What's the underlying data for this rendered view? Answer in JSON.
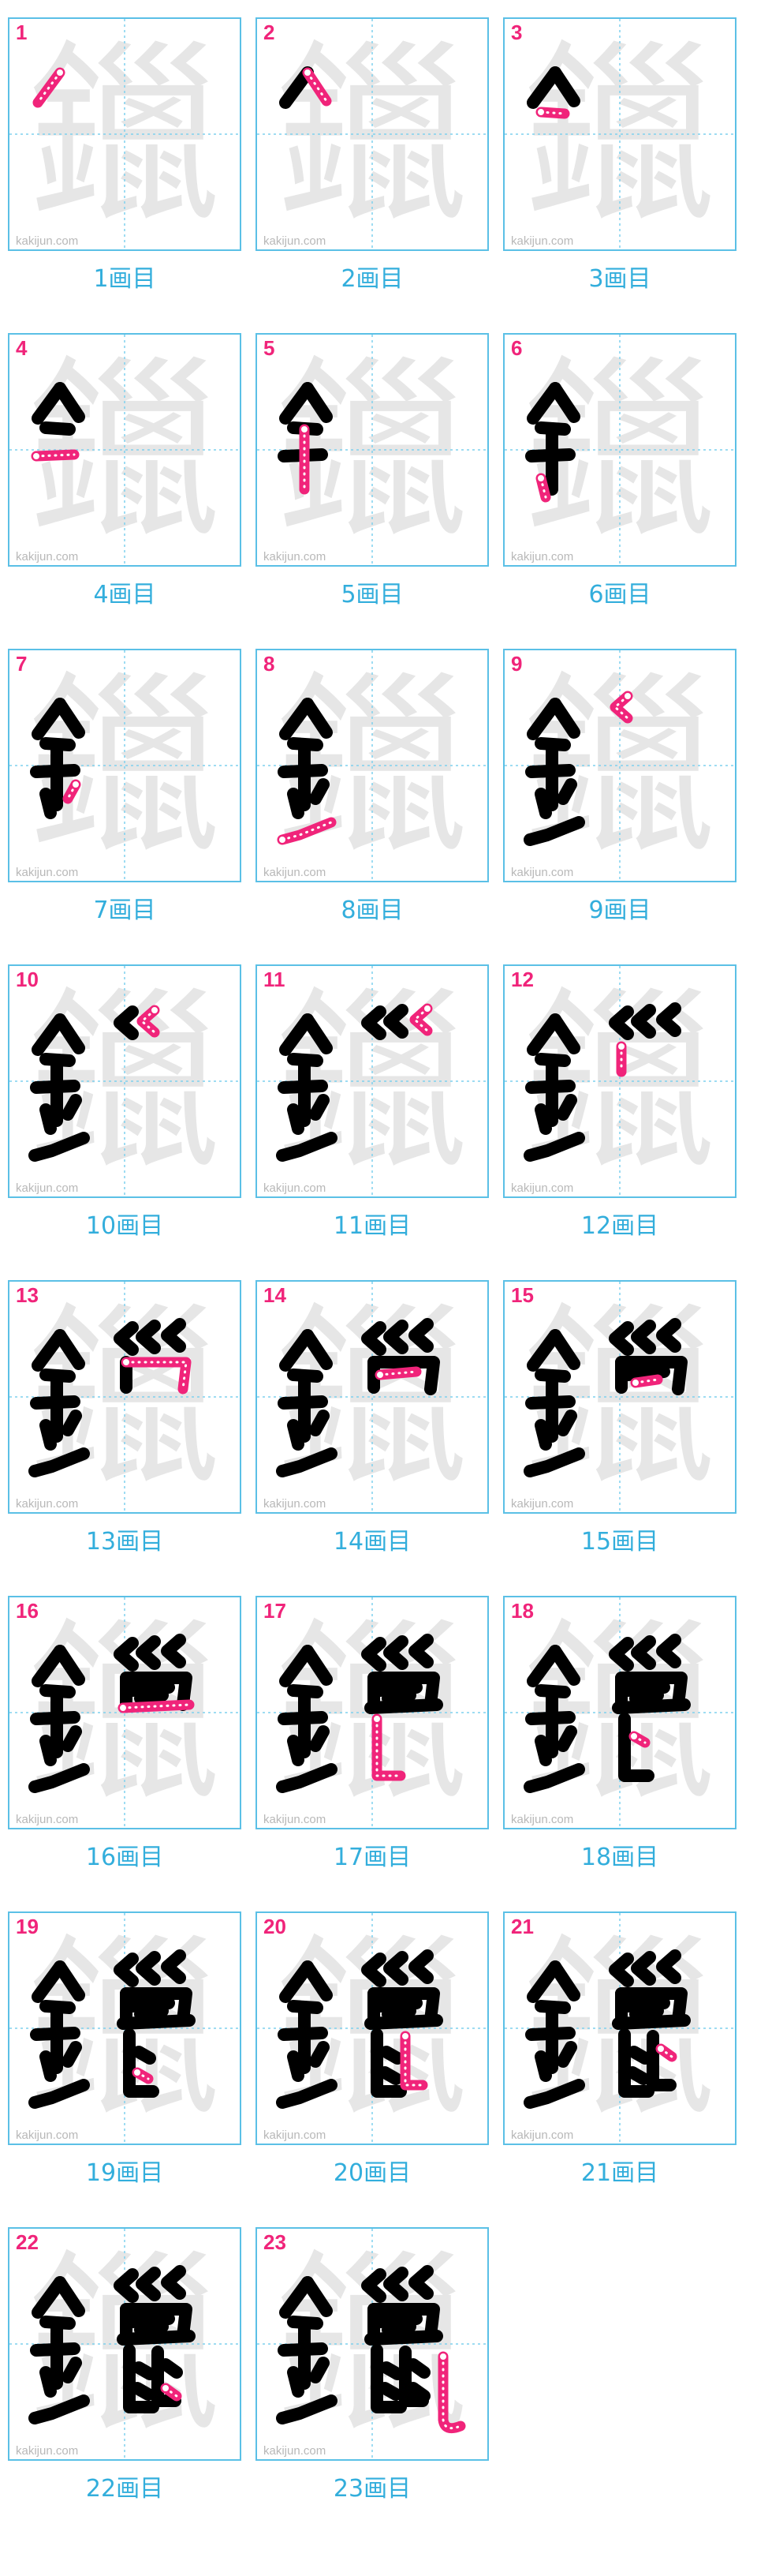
{
  "character": "鑞",
  "watermark": "kakijun.com",
  "caption_suffix": "画目",
  "colors": {
    "border": "#5bc0e6",
    "number": "#f0247a",
    "caption": "#33aedc",
    "ghost": "#e6e6e6",
    "ink": "#000000",
    "highlight": "#f0247a"
  },
  "steps": [
    {
      "number": "1"
    },
    {
      "number": "2"
    },
    {
      "number": "3"
    },
    {
      "number": "4"
    },
    {
      "number": "5"
    },
    {
      "number": "6"
    },
    {
      "number": "7"
    },
    {
      "number": "8"
    },
    {
      "number": "9"
    },
    {
      "number": "10"
    },
    {
      "number": "11"
    },
    {
      "number": "12"
    },
    {
      "number": "13"
    },
    {
      "number": "14"
    },
    {
      "number": "15"
    },
    {
      "number": "16"
    },
    {
      "number": "17"
    },
    {
      "number": "18"
    },
    {
      "number": "19"
    },
    {
      "number": "20"
    },
    {
      "number": "21"
    },
    {
      "number": "22"
    },
    {
      "number": "23"
    }
  ]
}
